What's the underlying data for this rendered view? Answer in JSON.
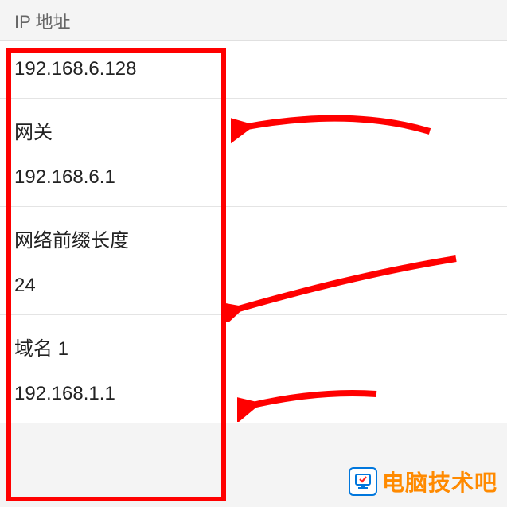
{
  "header": {
    "title": "IP 地址"
  },
  "fields": {
    "ip": {
      "value": "192.168.6.128"
    },
    "gateway": {
      "label": "网关",
      "value": "192.168.6.1"
    },
    "prefix": {
      "label": "网络前缀长度",
      "value": "24"
    },
    "dns1": {
      "label": "域名 1",
      "value": "192.168.1.1"
    }
  },
  "annotations": {
    "arrow_color": "#ff0000",
    "box_color": "#ff0000"
  },
  "watermark": {
    "text": "电脑技术吧",
    "brand_color": "#ff8a00"
  }
}
